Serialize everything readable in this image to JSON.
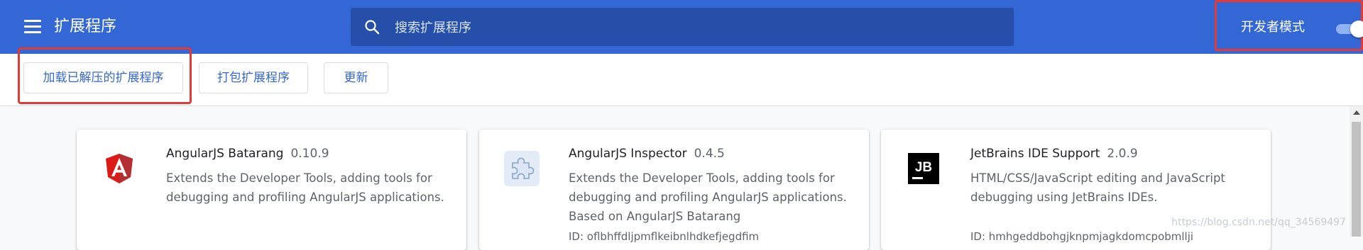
{
  "header": {
    "title": "扩展程序",
    "search_placeholder": "搜索扩展程序",
    "devmode_label": "开发者模式",
    "devmode_on": true,
    "bg_color": "#3367d6"
  },
  "toolbar": {
    "load_label": "加载已解压的扩展程序",
    "pack_label": "打包扩展程序",
    "update_label": "更新"
  },
  "extensions": [
    {
      "name": "AngularJS Batarang",
      "version": "0.10.9",
      "description": "Extends the Developer Tools, adding tools for debugging and profiling AngularJS applications.",
      "icon": "angular-icon"
    },
    {
      "name": "AngularJS Inspector",
      "version": "0.4.5",
      "description": "Extends the Developer Tools, adding tools for debugging and profiling AngularJS applications. Based on AngularJS Batarang",
      "id_partial": "ID: oflbhffdljpmflkeibnlhdkefjegdfim",
      "icon": "puzzle-icon"
    },
    {
      "name": "JetBrains IDE Support",
      "version": "2.0.9",
      "description": "HTML/CSS/JavaScript editing and JavaScript debugging using JetBrains IDEs.",
      "id_partial": "ID: hmhgeddbohgjknpmjagkdomcpobmllji",
      "icon": "jetbrains-icon"
    }
  ],
  "watermark": "https://blog.csdn.net/qq_34569497"
}
